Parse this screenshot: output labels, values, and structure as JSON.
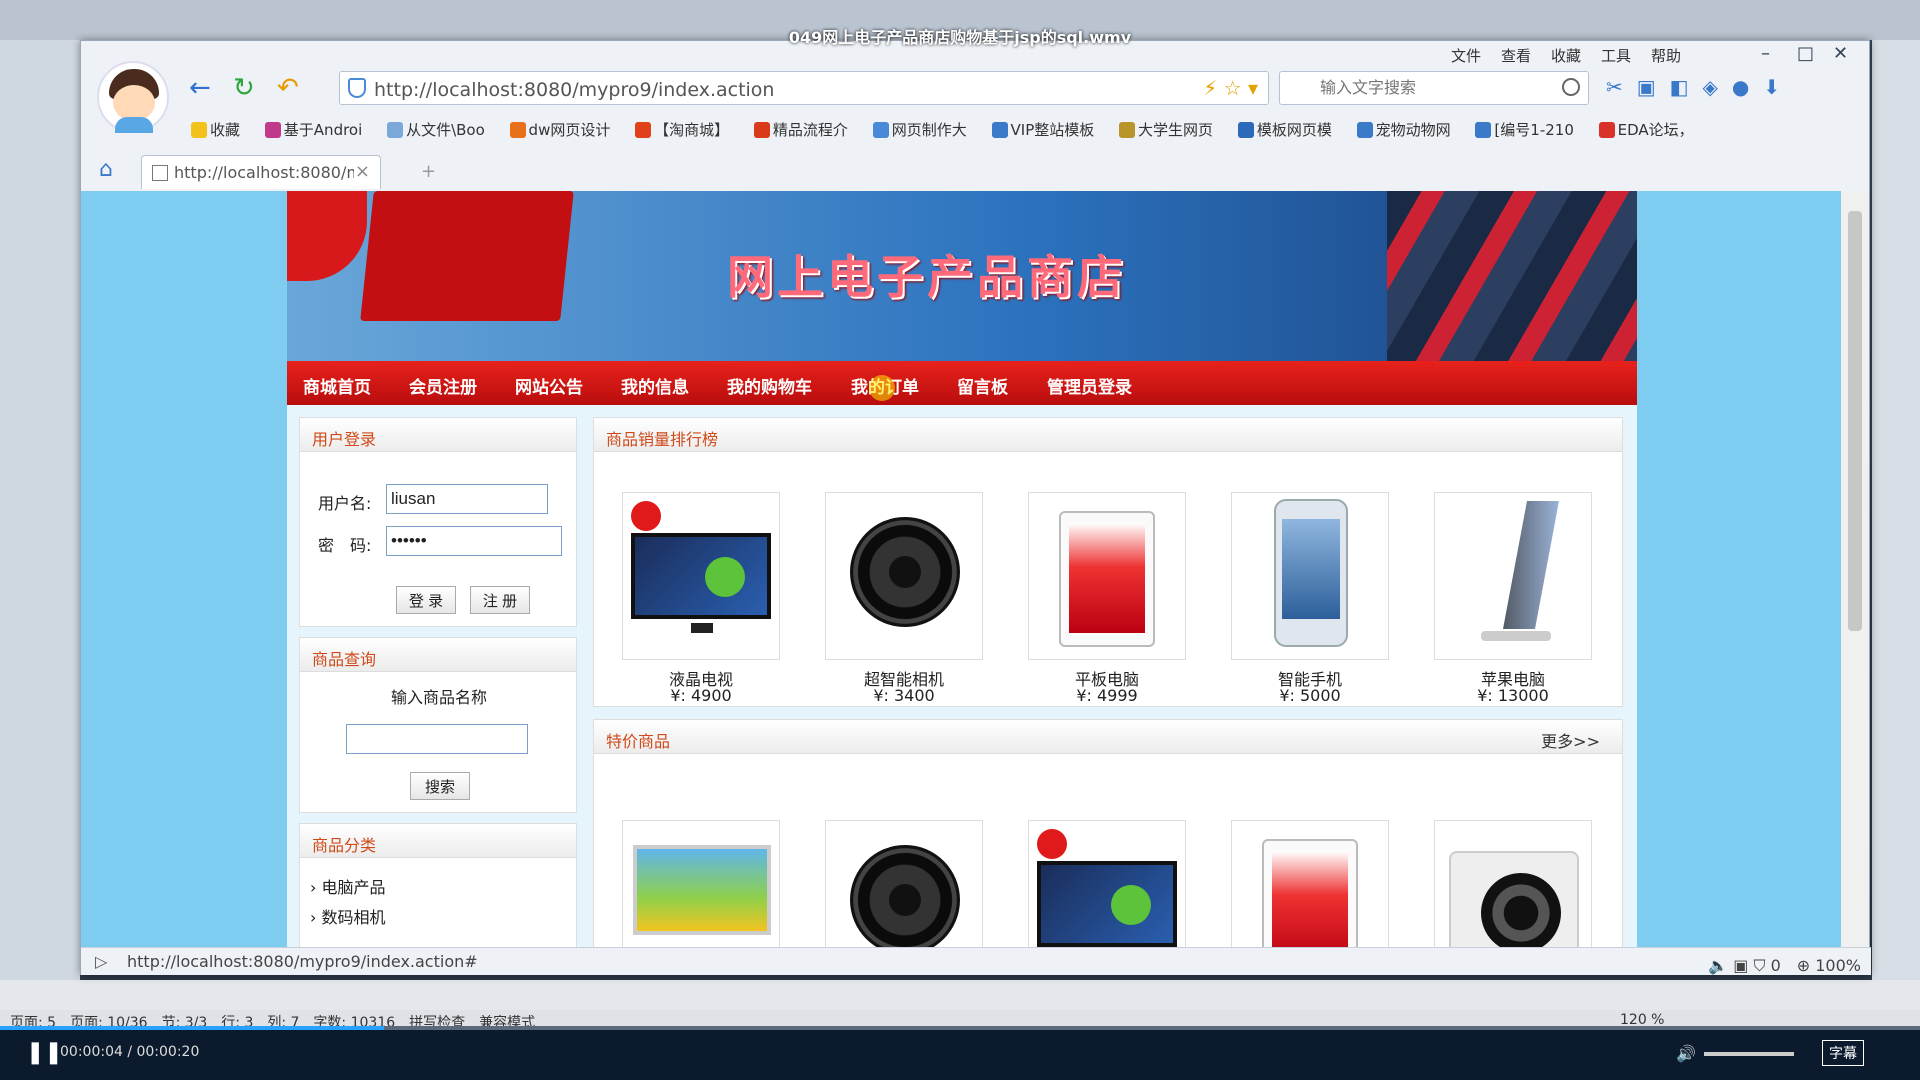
{
  "player": {
    "title": "049网上电子产品商店购物基于jsp的sql.wmv",
    "time": "00:00:04 / 00:00:20",
    "progress": 0.2,
    "subtitle_btn": "字幕"
  },
  "browser": {
    "menu": [
      "文件",
      "查看",
      "收藏",
      "工具",
      "帮助"
    ],
    "url": "http://localhost:8080/mypro9/index.action",
    "search_placeholder": "输入文字搜索",
    "bookmarks": [
      "收藏",
      "基于Androi",
      "从文件\\Boo",
      "dw网页设计",
      "【淘商城】",
      "精品流程介",
      "网页制作大",
      "VIP整站模板",
      "大学生网页",
      "模板网页模",
      "宠物动物网",
      "[编号1-210",
      "EDA论坛，"
    ],
    "tab_title": "http://localhost:8080/m",
    "status_url": "http://localhost:8080/mypro9/index.action#",
    "zoom": "100%",
    "blocked_count": "0"
  },
  "shop": {
    "title": "网上电子产品商店",
    "nav": [
      "商城首页",
      "会员注册",
      "网站公告",
      "我的信息",
      "我的购物车",
      "我的订单",
      "留言板",
      "管理员登录"
    ],
    "login": {
      "header": "用户登录",
      "username_label": "用户名:",
      "username_value": "liusan",
      "password_label": "密　码:",
      "password_value": "••••••",
      "login_btn": "登 录",
      "register_btn": "注 册"
    },
    "search": {
      "header": "商品查询",
      "prompt": "输入商品名称",
      "button": "搜索"
    },
    "category": {
      "header": "商品分类",
      "items": [
        "电脑产品",
        "数码相机"
      ]
    },
    "ranking": {
      "header": "商品销量排行榜",
      "products": [
        {
          "name": "液晶电视",
          "price": "¥: 4900"
        },
        {
          "name": "超智能相机",
          "price": "¥: 3400"
        },
        {
          "name": "平板电脑",
          "price": "¥: 4999"
        },
        {
          "name": "智能手机",
          "price": "¥: 5000"
        },
        {
          "name": "苹果电脑",
          "price": "¥: 13000"
        }
      ]
    },
    "special": {
      "header": "特价商品",
      "more": "更多>>"
    }
  },
  "ide_status": {
    "text": "页面: 5　页面: 10/36　节: 3/3　行: 3　列: 7　字数: 10316　拼写检查　兼容模式",
    "zoom": "120 %"
  }
}
